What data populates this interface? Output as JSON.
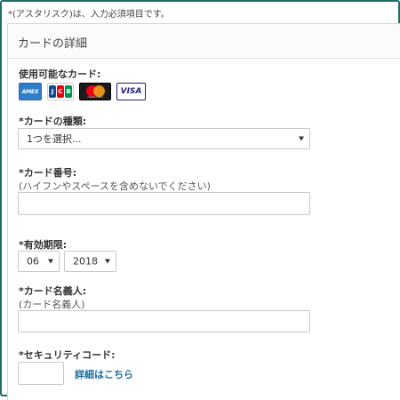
{
  "required_note": "*(アスタリスク)は、入力必須項目です。",
  "panel": {
    "title": "カードの詳細"
  },
  "accepted_cards": {
    "label": "使用可能なカード:",
    "cards": [
      {
        "name": "amex",
        "text": "AMEX"
      },
      {
        "name": "jcb",
        "text": "JCB"
      },
      {
        "name": "mastercard",
        "text": "mastercard"
      },
      {
        "name": "visa",
        "text": "VISA"
      }
    ]
  },
  "card_type": {
    "label": "*カードの種類:",
    "selected": "1つを選択..."
  },
  "card_number": {
    "label": "*カード番号:",
    "hint": "(ハイフンやスペースを含めないでください)",
    "value": ""
  },
  "expiry": {
    "label": "*有効期限:",
    "month": "06",
    "year": "2018"
  },
  "card_holder": {
    "label": "*カード名義人:",
    "hint": "(カード名義人)",
    "value": ""
  },
  "security_code": {
    "label": "*セキュリティコード:",
    "value": "",
    "details_link": "詳細はこちら"
  },
  "colors": {
    "frame_border": "#1f6e62",
    "link": "#1a6e9e"
  }
}
